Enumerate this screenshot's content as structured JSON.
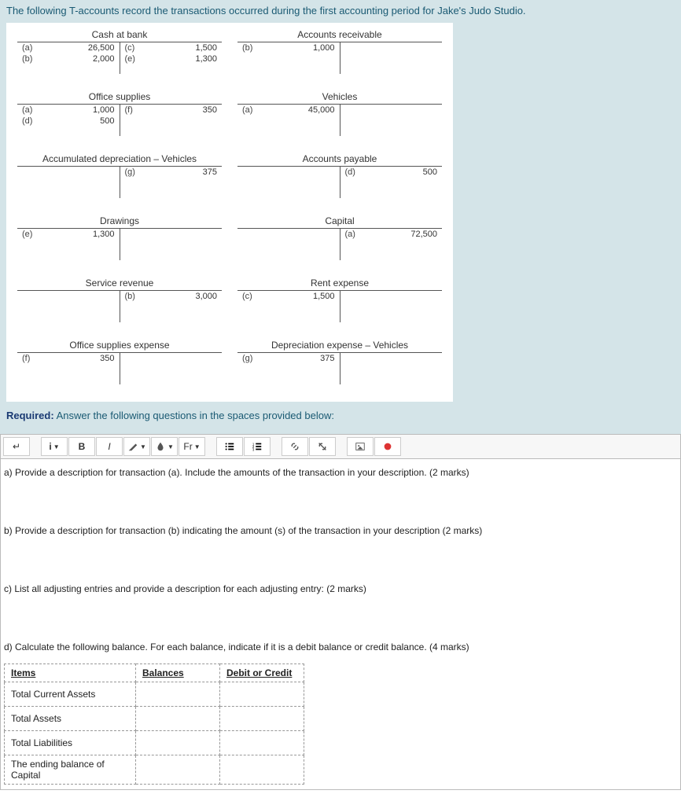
{
  "intro": "The following T-accounts record the transactions occurred during the first accounting period for Jake's Judo Studio.",
  "accounts": {
    "cash_at_bank": {
      "title": "Cash at bank",
      "debits": [
        {
          "ref": "(a)",
          "amt": "26,500"
        },
        {
          "ref": "(b)",
          "amt": "2,000"
        }
      ],
      "credits": [
        {
          "ref": "(c)",
          "amt": "1,500"
        },
        {
          "ref": "(e)",
          "amt": "1,300"
        }
      ]
    },
    "accounts_receivable": {
      "title": "Accounts receivable",
      "debits": [
        {
          "ref": "(b)",
          "amt": "1,000"
        }
      ],
      "credits": []
    },
    "office_supplies": {
      "title": "Office supplies",
      "debits": [
        {
          "ref": "(a)",
          "amt": "1,000"
        },
        {
          "ref": "(d)",
          "amt": "500"
        }
      ],
      "credits": [
        {
          "ref": "(f)",
          "amt": "350"
        }
      ]
    },
    "vehicles": {
      "title": "Vehicles",
      "debits": [
        {
          "ref": "(a)",
          "amt": "45,000"
        }
      ],
      "credits": []
    },
    "accum_dep_vehicles": {
      "title": "Accumulated depreciation – Vehicles",
      "debits": [],
      "credits": [
        {
          "ref": "(g)",
          "amt": "375"
        }
      ]
    },
    "accounts_payable": {
      "title": "Accounts payable",
      "debits": [],
      "credits": [
        {
          "ref": "(d)",
          "amt": "500"
        }
      ]
    },
    "drawings": {
      "title": "Drawings",
      "debits": [
        {
          "ref": "(e)",
          "amt": "1,300"
        }
      ],
      "credits": []
    },
    "capital": {
      "title": "Capital",
      "debits": [],
      "credits": [
        {
          "ref": "(a)",
          "amt": "72,500"
        }
      ]
    },
    "service_revenue": {
      "title": "Service revenue",
      "debits": [],
      "credits": [
        {
          "ref": "(b)",
          "amt": "3,000"
        }
      ]
    },
    "rent_expense": {
      "title": "Rent expense",
      "debits": [
        {
          "ref": "(c)",
          "amt": "1,500"
        }
      ],
      "credits": []
    },
    "office_supplies_expense": {
      "title": "Office supplies expense",
      "debits": [
        {
          "ref": "(f)",
          "amt": "350"
        }
      ],
      "credits": []
    },
    "dep_exp_vehicles": {
      "title": "Depreciation expense – Vehicles",
      "debits": [
        {
          "ref": "(g)",
          "amt": "375"
        }
      ],
      "credits": []
    }
  },
  "required_label": "Required:",
  "required_text": "Answer the following questions in the spaces provided below:",
  "toolbar": {
    "bold": "B",
    "italic": "I",
    "font": "Fr"
  },
  "questions": {
    "a": "a)    Provide a description for transaction (a). Include the amounts of the transaction in your description. (2 marks)",
    "b": "b)    Provide a description for transaction (b) indicating the amount (s) of the transaction in your description (2 marks)",
    "c": "c)    List all adjusting entries and provide a description for each adjusting entry: (2 marks)",
    "d": "d)    Calculate the following balance. For each balance, indicate if it is a debit balance or credit balance. (4 marks)"
  },
  "balance_table": {
    "headers": {
      "items": "Items",
      "balances": "Balances",
      "dc": "Debit or Credit"
    },
    "rows": [
      "Total Current Assets",
      "Total Assets",
      "Total Liabilities",
      "The ending balance of Capital"
    ]
  }
}
